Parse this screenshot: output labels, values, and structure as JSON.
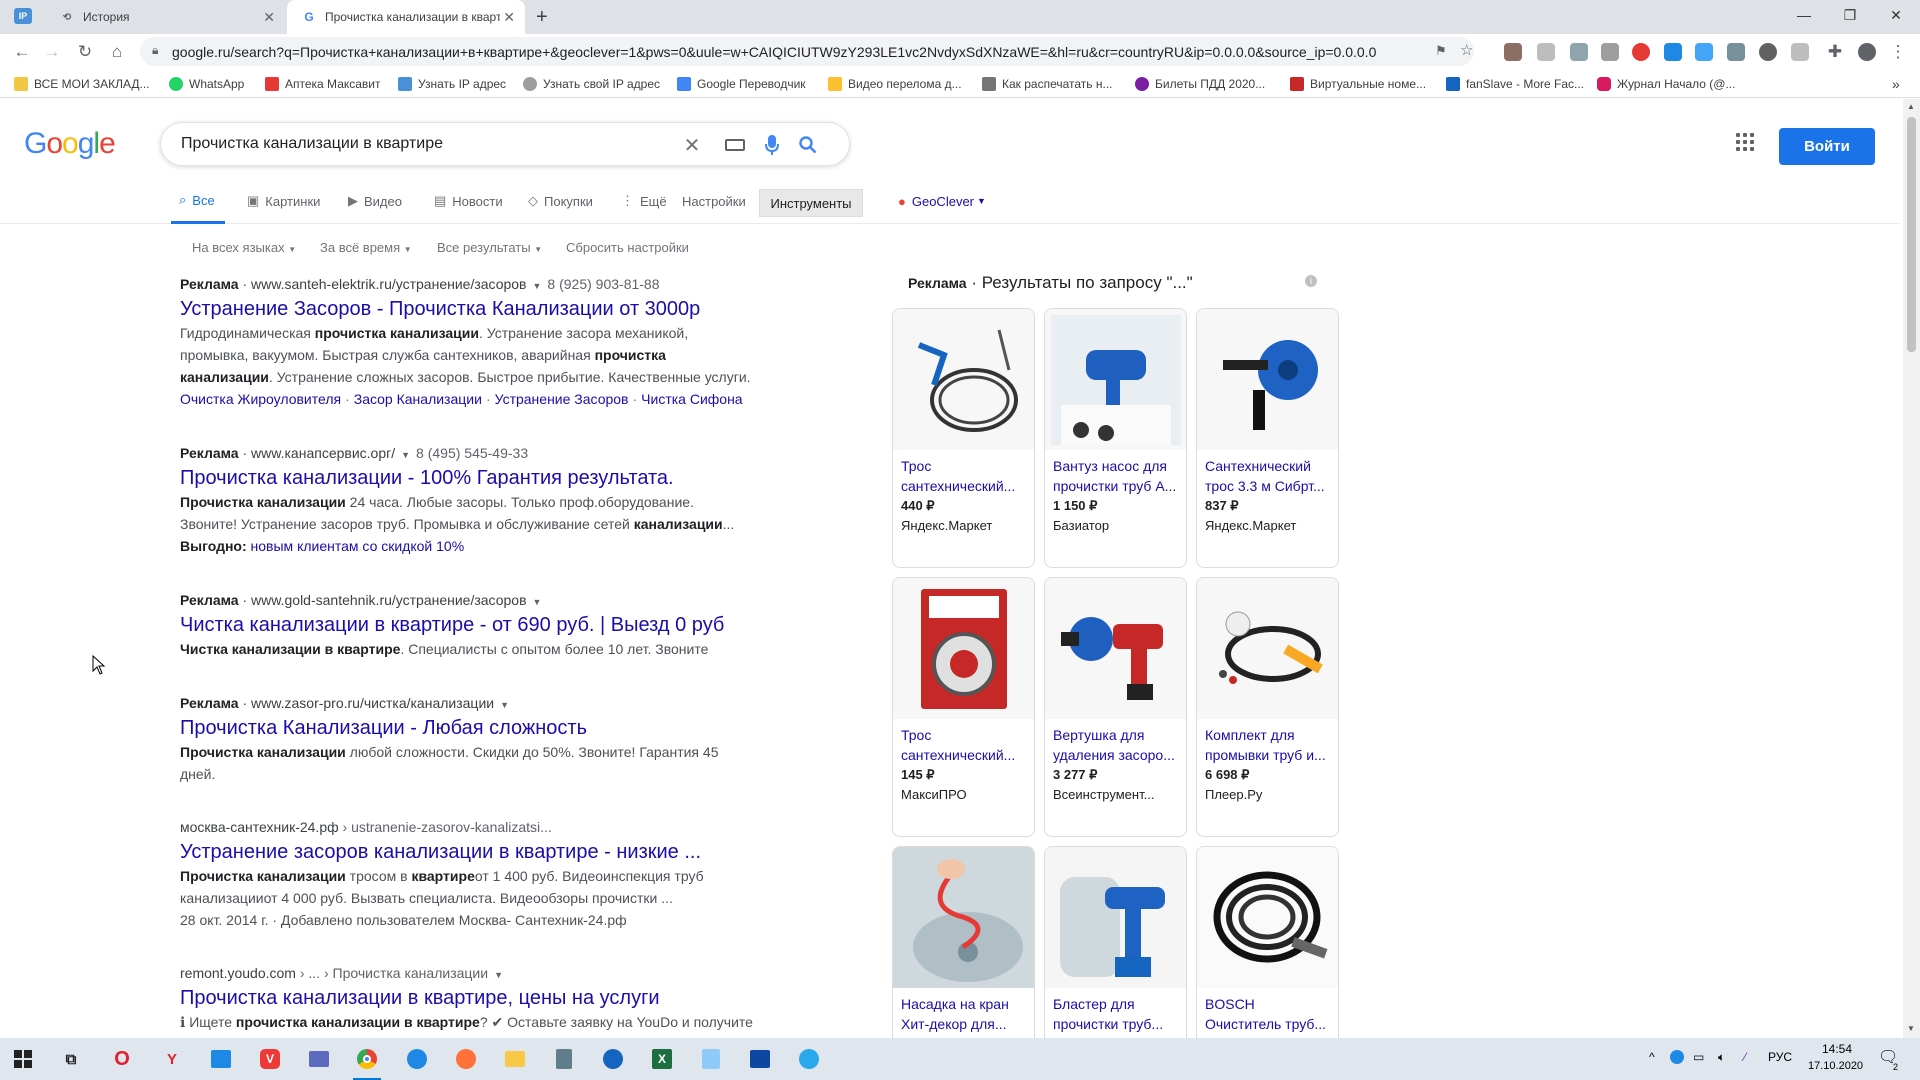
{
  "browser": {
    "tabs": [
      {
        "label": "История",
        "active": false
      },
      {
        "label": "Прочистка канализации в кварт",
        "active": true
      }
    ],
    "url": "google.ru/search?q=Прочистка+канализации+в+квартире+&geoclever=1&pws=0&uule=w+CAIQICIUTW9zY293LE1vc2NvdyxSdXNzaWE=&hl=ru&cr=countryRU&ip=0.0.0.0&source_ip=0.0.0.0",
    "bookmarks": [
      {
        "label": "ВСЕ МОИ ЗАКЛАД...",
        "color": "#f2c744"
      },
      {
        "label": "WhatsApp",
        "color": "#25d366"
      },
      {
        "label": "Аптека Максавит",
        "color": "#e53935"
      },
      {
        "label": "Узнать IP адрес",
        "color": "#4a90d9"
      },
      {
        "label": "Узнать свой IP адрес",
        "color": "#9e9e9e"
      },
      {
        "label": "Google Переводчик",
        "color": "#4285f4"
      },
      {
        "label": "Видео перелома д...",
        "color": "#fbc02d"
      },
      {
        "label": "Как распечатать н...",
        "color": "#757575"
      },
      {
        "label": "Билеты ПДД 2020...",
        "color": "#7b1fa2"
      },
      {
        "label": "Виртуальные номе...",
        "color": "#c62828"
      },
      {
        "label": "fanSlave - More Fac...",
        "color": "#1565c0"
      },
      {
        "label": "Журнал Начало (@...",
        "color": "#d81b60"
      }
    ],
    "more_bookmarks": "»"
  },
  "google": {
    "logo_letters": [
      {
        "ch": "G",
        "color": "#4285f4"
      },
      {
        "ch": "o",
        "color": "#ea4335"
      },
      {
        "ch": "o",
        "color": "#fbbc05"
      },
      {
        "ch": "g",
        "color": "#4285f4"
      },
      {
        "ch": "l",
        "color": "#34a853"
      },
      {
        "ch": "e",
        "color": "#ea4335"
      }
    ],
    "query": "Прочистка канализации в квартире",
    "signin": "Войти",
    "tabs": [
      {
        "label": "Все",
        "icon": "search-icon",
        "active": true
      },
      {
        "label": "Картинки",
        "icon": "image-icon"
      },
      {
        "label": "Видео",
        "icon": "video-icon"
      },
      {
        "label": "Новости",
        "icon": "news-icon"
      },
      {
        "label": "Покупки",
        "icon": "tag-icon"
      },
      {
        "label": "Ещё",
        "icon": "more-icon"
      },
      {
        "label": "Настройки"
      }
    ],
    "tools": "Инструменты",
    "geoclever": "GeoClever",
    "filters": [
      "На всех языках",
      "За всё время",
      "Все результаты",
      "Сбросить настройки"
    ]
  },
  "results": [
    {
      "ad_label": "Реклама",
      "url": "www.santeh-elektrik.ru/устранение/засоров",
      "phone": "8 (925) 903-81-88",
      "title": "Устранение Засоров - Прочистка Канализации от 3000р",
      "snippet_lines": [
        [
          {
            "t": "Гидродинамическая "
          },
          {
            "t": "прочистка канализации",
            "b": true
          },
          {
            "t": ". Устранение засора механикой,"
          }
        ],
        [
          {
            "t": "промывка, вакуумом. Быстрая служба сантехников, аварийная "
          },
          {
            "t": "прочистка",
            "b": true
          }
        ],
        [
          {
            "t": "канализации",
            "b": true
          },
          {
            "t": ". Устранение сложных засоров. Быстрое прибытие. Качественные услуги."
          }
        ]
      ],
      "sitelinks": [
        "Очистка Жироуловителя",
        "Засор Канализации",
        "Устранение Засоров",
        "Чистка Сифона"
      ]
    },
    {
      "ad_label": "Реклама",
      "url": "www.канапсервис.орг/",
      "phone": "8 (495) 545-49-33",
      "title": "Прочистка канализации - 100% Гарантия результата.",
      "snippet_lines": [
        [
          {
            "t": "Прочистка канализации",
            "b": true
          },
          {
            "t": " 24 часа. Любые засоры. Только проф.оборудование."
          }
        ],
        [
          {
            "t": "Звоните! Устранение засоров труб. Промывка и обслуживание сетей "
          },
          {
            "t": "канализации",
            "b": true
          },
          {
            "t": "..."
          }
        ]
      ],
      "extra_label": "Выгодно:",
      "extra_link": "новым клиентам со скидкой 10%"
    },
    {
      "ad_label": "Реклама",
      "url": "www.gold-santehnik.ru/устранение/засоров",
      "title": "Чистка канализации в квартире - от 690 руб. | Выезд 0 руб",
      "snippet_lines": [
        [
          {
            "t": "Чистка канализации в квартире",
            "b": true
          },
          {
            "t": ". Специалисты с опытом более 10 лет. Звоните"
          }
        ]
      ]
    },
    {
      "ad_label": "Реклама",
      "url": "www.zasor-pro.ru/чистка/канализации",
      "title": "Прочистка Канализации - Любая сложность",
      "snippet_lines": [
        [
          {
            "t": "Прочистка канализации",
            "b": true
          },
          {
            "t": " любой сложности. Скидки до 50%. Звоните! Гарантия 45"
          }
        ],
        [
          {
            "t": "дней."
          }
        ]
      ]
    },
    {
      "url": "москва-сантехник-24.рф",
      "crumb": "› ustranenie-zasorov-kanalizatsi...",
      "title": "Устранение засоров канализации в квартире - низкие ...",
      "snippet_lines": [
        [
          {
            "t": "Прочистка канализации",
            "b": true
          },
          {
            "t": " тросом в "
          },
          {
            "t": "квартире",
            "b": true
          },
          {
            "t": "от 1 400 руб. Видеоинспекция труб"
          }
        ],
        [
          {
            "t": "канализацииот 4 000 руб. Вызвать специалиста. Видеообзоры прочистки ..."
          }
        ],
        [
          {
            "t": "28 окт. 2014 г. · Добавлено пользователем Москва- Сантехник-24.рф"
          }
        ]
      ]
    },
    {
      "url": "remont.youdo.com",
      "crumb": "› ... › Прочистка канализации",
      "title": "Прочистка канализации в квартире, цены на услуги",
      "snippet_lines": [
        [
          {
            "t": "ℹ Ищете "
          },
          {
            "t": "прочистка канализации в квартире",
            "b": true
          },
          {
            "t": "? ✔ Оставьте заявку на YouDo и получите"
          }
        ]
      ]
    }
  ],
  "shopping": {
    "ad_label": "Реклама",
    "header": "· Результаты по запросу \"...\"",
    "products": [
      {
        "name": "Трос сантехнический...",
        "price": "440 ₽",
        "store": "Яндекс.Маркет",
        "image": "cable-coil"
      },
      {
        "name": "Вантуз насос для прочистки труб А...",
        "price": "1 150 ₽",
        "store": "Базиатор",
        "image": "plunger-pump"
      },
      {
        "name": "Сантехнический трос 3.3 м Сибрт...",
        "price": "837 ₽",
        "store": "Яндекс.Маркет",
        "image": "drum-auger"
      },
      {
        "name": "Трос сантехнический...",
        "price": "145 ₽",
        "store": "МаксиПРО",
        "image": "cable-pack"
      },
      {
        "name": "Вертушка для удаления засоро...",
        "price": "3 277 ₽",
        "store": "Всеинструмент...",
        "image": "drill-auger"
      },
      {
        "name": "Комплект для промывки труб и...",
        "price": "6 698 ₽",
        "store": "Плеер.Ру",
        "image": "hose-kit"
      },
      {
        "name": "Насадка на кран Хит-декор для...",
        "price": "",
        "store": "",
        "image": "sink-hand"
      },
      {
        "name": "Бластер для прочистки труб...",
        "price": "",
        "store": "",
        "image": "toilet-blaster"
      },
      {
        "name": "BOSCH Очиститель труб...",
        "price": "",
        "store": "",
        "image": "black-hose"
      }
    ]
  },
  "taskbar": {
    "lang": "РУС",
    "time": "14:54",
    "date": "17.10.2020",
    "notifications": "2"
  }
}
